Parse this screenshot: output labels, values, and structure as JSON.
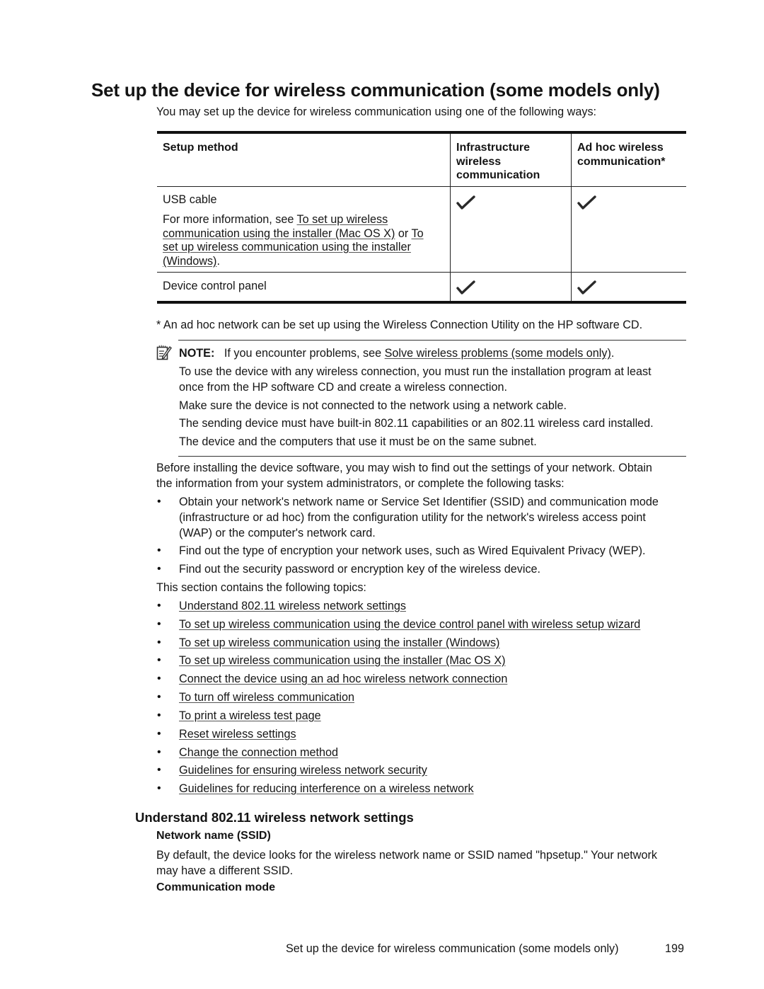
{
  "page": {
    "title": "Set up the device for wireless communication (some models only)",
    "intro": "You may set up the device for wireless communication using one of the following ways:"
  },
  "table": {
    "headers": {
      "method": "Setup method",
      "infra_line1": "Infrastructure",
      "infra_line2": "wireless",
      "infra_line3": "communication",
      "adhoc_line1": "Ad hoc wireless",
      "adhoc_line2": "communication*"
    },
    "rows": [
      {
        "method": "USB cable",
        "info_prefix": "For more information, see ",
        "link1_line1": "To set up wireless",
        "link1_line2": "communication using the installer (Mac OS X)",
        "connector": " or ",
        "link2_line1": "To",
        "link2_line2": "set up wireless communication using the installer",
        "link2_line3": "(Windows)",
        "suffix": ".",
        "infrastructure": "check-icon",
        "adhoc": "check-icon"
      },
      {
        "method": "Device control panel",
        "infrastructure": "check-icon",
        "adhoc": "check-icon"
      }
    ]
  },
  "footnote": "* An ad hoc network can be set up using the Wireless Connection Utility on the HP software CD.",
  "note": {
    "icon": "note-pencil-icon",
    "label": "NOTE:",
    "text_prefix": "If you encounter problems, see ",
    "link": "Solve wireless problems (some models only)",
    "text_suffix": ".",
    "para1_line1": "To use the device with any wireless connection, you must run the installation program at least",
    "para1_line2": "once from the HP software CD and create a wireless connection.",
    "para2": "Make sure the device is not connected to the network using a network cable.",
    "para3": "The sending device must have built-in 802.11 capabilities or an 802.11 wireless card installed.",
    "para4": "The device and the computers that use it must be on the same subnet."
  },
  "before": {
    "line1": "Before installing the device software, you may wish to find out the settings of your network. Obtain",
    "line2": "the information from your system administrators, or complete the following tasks:",
    "tasks": [
      {
        "l1": "Obtain your network's network name or Service Set Identifier (SSID) and communication mode",
        "l2": "(infrastructure or ad hoc) from the configuration utility for the network's wireless access point",
        "l3": "(WAP) or the computer's network card."
      },
      {
        "l1": "Find out the type of encryption your network uses, such as Wired Equivalent Privacy (WEP)."
      },
      {
        "l1": "Find out the security password or encryption key of the wireless device."
      }
    ],
    "topics_intro": "This section contains the following topics:"
  },
  "topics": [
    "Understand 802.11 wireless network settings",
    "To set up wireless communication using the device control panel with wireless setup wizard",
    "To set up wireless communication using the installer (Windows)",
    "To set up wireless communication using the installer (Mac OS X)",
    "Connect the device using an ad hoc wireless network connection",
    "To turn off wireless communication",
    "To print a wireless test page",
    "Reset wireless settings",
    "Change the connection method",
    "Guidelines for ensuring wireless network security",
    "Guidelines for reducing interference on a wireless network"
  ],
  "bullet_char": "•",
  "section": {
    "heading": "Understand 802.11 wireless network settings",
    "ssid_heading": "Network name (SSID)",
    "ssid_line1": "By default, the device looks for the wireless network name or SSID named \"hpsetup.\" Your network",
    "ssid_line2": "may have a different SSID.",
    "mode_heading": "Communication mode"
  },
  "footer": {
    "title": "Set up the device for wireless communication (some models only)",
    "page_number": "199"
  }
}
